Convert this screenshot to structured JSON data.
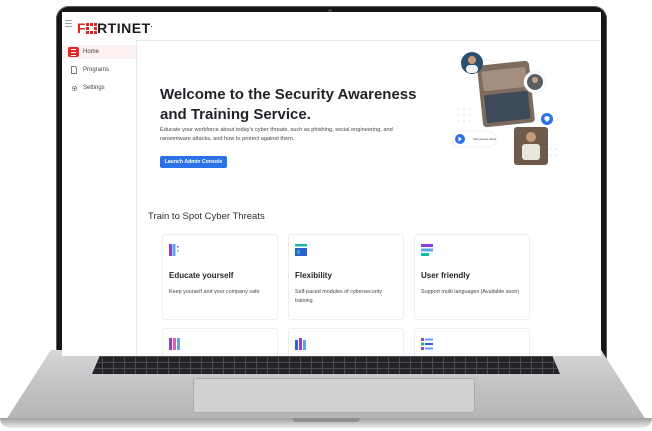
{
  "app": {
    "logo_text": "FORTINET",
    "brand_color": "#da291c",
    "accent_color": "#2a72e5"
  },
  "sidebar": {
    "items": [
      {
        "label": "Home",
        "icon": "home-icon",
        "active": true
      },
      {
        "label": "Programs",
        "icon": "document-icon",
        "active": false
      },
      {
        "label": "Settings",
        "icon": "gear-icon",
        "active": false
      }
    ]
  },
  "hero": {
    "title": "Welcome to the Security Awareness and Training Service.",
    "description": "Educate your workforce about today's cyber threats, such as phishing, social engineering, and ransomware attacks, and how to protect against them.",
    "button_label": "Launch Admin Console",
    "preview_chip": "Start preview videos"
  },
  "features": {
    "section_title": "Train to Spot Cyber Threats",
    "cards": [
      {
        "title": "Educate yourself",
        "description": "Keep yourself and your company safe",
        "icon": "book-icon"
      },
      {
        "title": "Flexibility",
        "description": "Self-paced modules of cybersecurity training",
        "icon": "layout-icon"
      },
      {
        "title": "User friendly",
        "description": "Support multi languages (Available soon)",
        "icon": "list-icon"
      },
      {
        "title": "",
        "description": "",
        "icon": "columns-icon"
      },
      {
        "title": "",
        "description": "",
        "icon": "columns-icon"
      },
      {
        "title": "",
        "description": "",
        "icon": "checklist-icon"
      }
    ]
  }
}
